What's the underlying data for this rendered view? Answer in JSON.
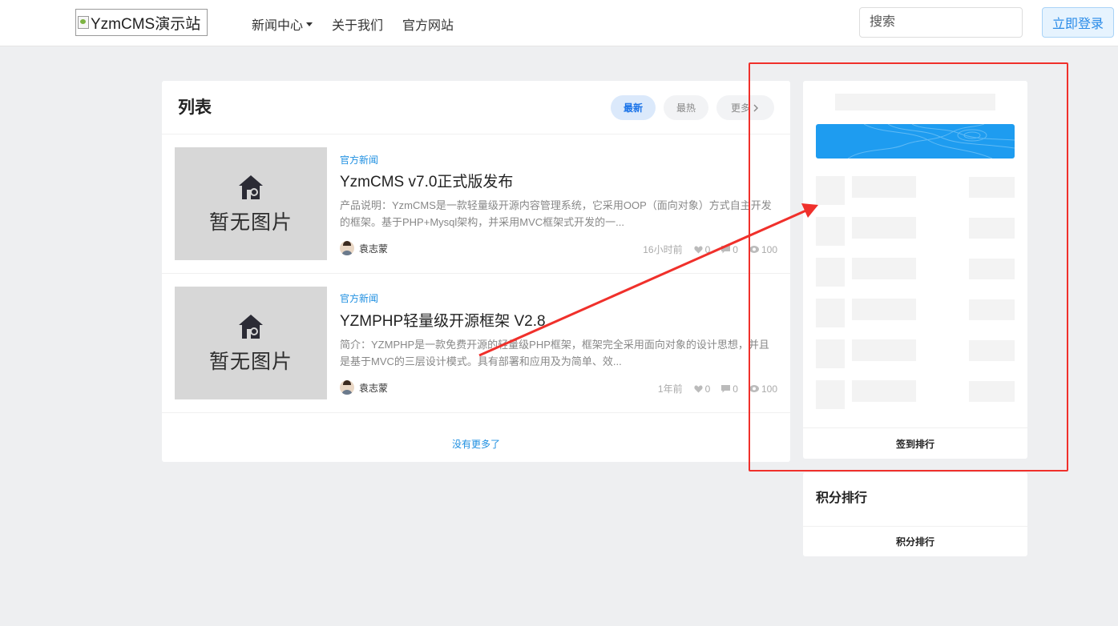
{
  "header": {
    "logo_alt": "YzmCMS演示站",
    "nav": [
      {
        "label": "新闻中心",
        "has_dropdown": true
      },
      {
        "label": "关于我们"
      },
      {
        "label": "官方网站"
      }
    ],
    "search_placeholder": "搜索",
    "login_label": "立即登录"
  },
  "list": {
    "title": "列表",
    "tabs": [
      {
        "label": "最新",
        "active": true
      },
      {
        "label": "最热"
      },
      {
        "label": "更多"
      }
    ],
    "items": [
      {
        "thumb_text": "暂无图片",
        "category": "官方新闻",
        "title": "YzmCMS v7.0正式版发布",
        "description": "产品说明：YzmCMS是一款轻量级开源内容管理系统，它采用OOP（面向对象）方式自主开发的框架。基于PHP+Mysql架构，并采用MVC框架式开发的一...",
        "author": "袁志蒙",
        "time": "16小时前",
        "likes": "0",
        "comments": "0",
        "views": "100"
      },
      {
        "thumb_text": "暂无图片",
        "category": "官方新闻",
        "title": "YZMPHP轻量级开源框架 V2.8",
        "description": "简介：YZMPHP是一款免费开源的轻量级PHP框架，框架完全采用面向对象的设计思想，并且是基于MVC的三层设计模式。具有部署和应用及为简单、效...",
        "author": "袁志蒙",
        "time": "1年前",
        "likes": "0",
        "comments": "0",
        "views": "100"
      }
    ],
    "no_more": "没有更多了"
  },
  "sidebar": {
    "checkin_footer": "签到排行",
    "score_title": "积分排行",
    "score_footer": "积分排行"
  },
  "colors": {
    "accent": "#1e8fe1",
    "banner": "#1e9cf0",
    "annotation": "#f0302b"
  }
}
